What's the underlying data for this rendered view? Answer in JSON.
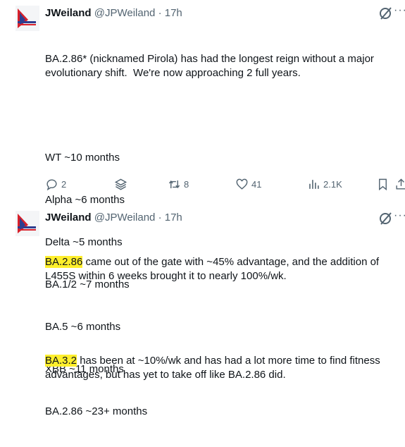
{
  "tweets": [
    {
      "author": "JWeiland",
      "handle": "@JPWeiland",
      "separator": "·",
      "time": "17h",
      "more_label": "···",
      "intro": "BA.2.86* (nicknamed Pirola) has had the longest reign without a major evolutionary shift.  We're now approaching 2 full years.",
      "lines": [
        "WT ~10 months",
        "Alpha ~6 months",
        "Delta ~5 months",
        "BA.1/2 ~7 months",
        "BA.5 ~6 months",
        "XBB ~11 months",
        "BA.2.86 ~23+ months"
      ],
      "actions": {
        "replies": "2",
        "retweets": "8",
        "likes": "41",
        "views": "2.1K"
      }
    },
    {
      "author": "JWeiland",
      "handle": "@JPWeiland",
      "separator": "·",
      "time": "17h",
      "more_label": "···",
      "p1_highlight": "BA.2.86",
      "p1_rest": " came out of the gate with ~45% advantage, and the addition of L455S within 6 weeks brought it to nearly 100%/wk.",
      "p2_highlight": "BA.3.2",
      "p2_rest": " has been at ~10%/wk and has had a lot more time to find fitness advantages, but has yet to take off like BA.2.86 did."
    }
  ],
  "colors": {
    "highlight": "#ffef2c",
    "avatar_red": "#d8202a",
    "avatar_blue": "#2f3e8f",
    "muted": "#536471"
  },
  "icons": [
    "avatar-flag",
    "grok-icon",
    "more-icon",
    "reply-icon",
    "layers-icon",
    "retweet-icon",
    "like-icon",
    "views-icon",
    "bookmark-icon",
    "share-icon"
  ]
}
